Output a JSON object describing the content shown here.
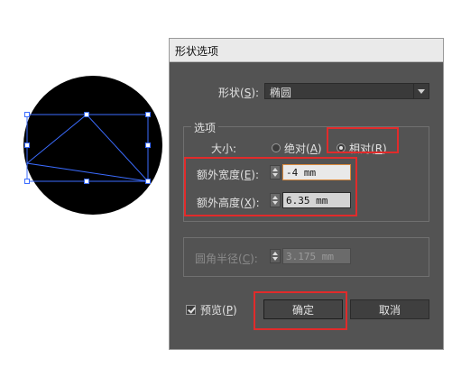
{
  "dialog": {
    "title": "形状选项",
    "shape": {
      "label_pre": "形状(",
      "label_key": "S",
      "label_post": "):",
      "value": "椭圆"
    },
    "options": {
      "group_label": "选项",
      "size_label": "大小:",
      "absolute": {
        "label_pre": "绝对(",
        "label_key": "A",
        "label_post": ")",
        "selected": false
      },
      "relative": {
        "label_pre": "相对(",
        "label_key": "R",
        "label_post": ")",
        "selected": true
      },
      "extra_width": {
        "label_pre": "额外宽度(",
        "label_key": "E",
        "label_post": "):",
        "value": "-4 mm"
      },
      "extra_height": {
        "label_pre": "额外高度(",
        "label_key": "X",
        "label_post": "):",
        "value": "6.35 mm"
      }
    },
    "corner_radius": {
      "label_pre": "圆角半径(",
      "label_key": "C",
      "label_post": "):",
      "value": "3.175 mm",
      "enabled": false
    },
    "preview": {
      "label_pre": "预览(",
      "label_key": "P",
      "label_post": ")",
      "checked": true
    },
    "ok_label": "确定",
    "cancel_label": "取消"
  },
  "colors": {
    "highlight": "#e12b2b",
    "dialog_bg": "#535353",
    "selection": "#3b6cff"
  }
}
